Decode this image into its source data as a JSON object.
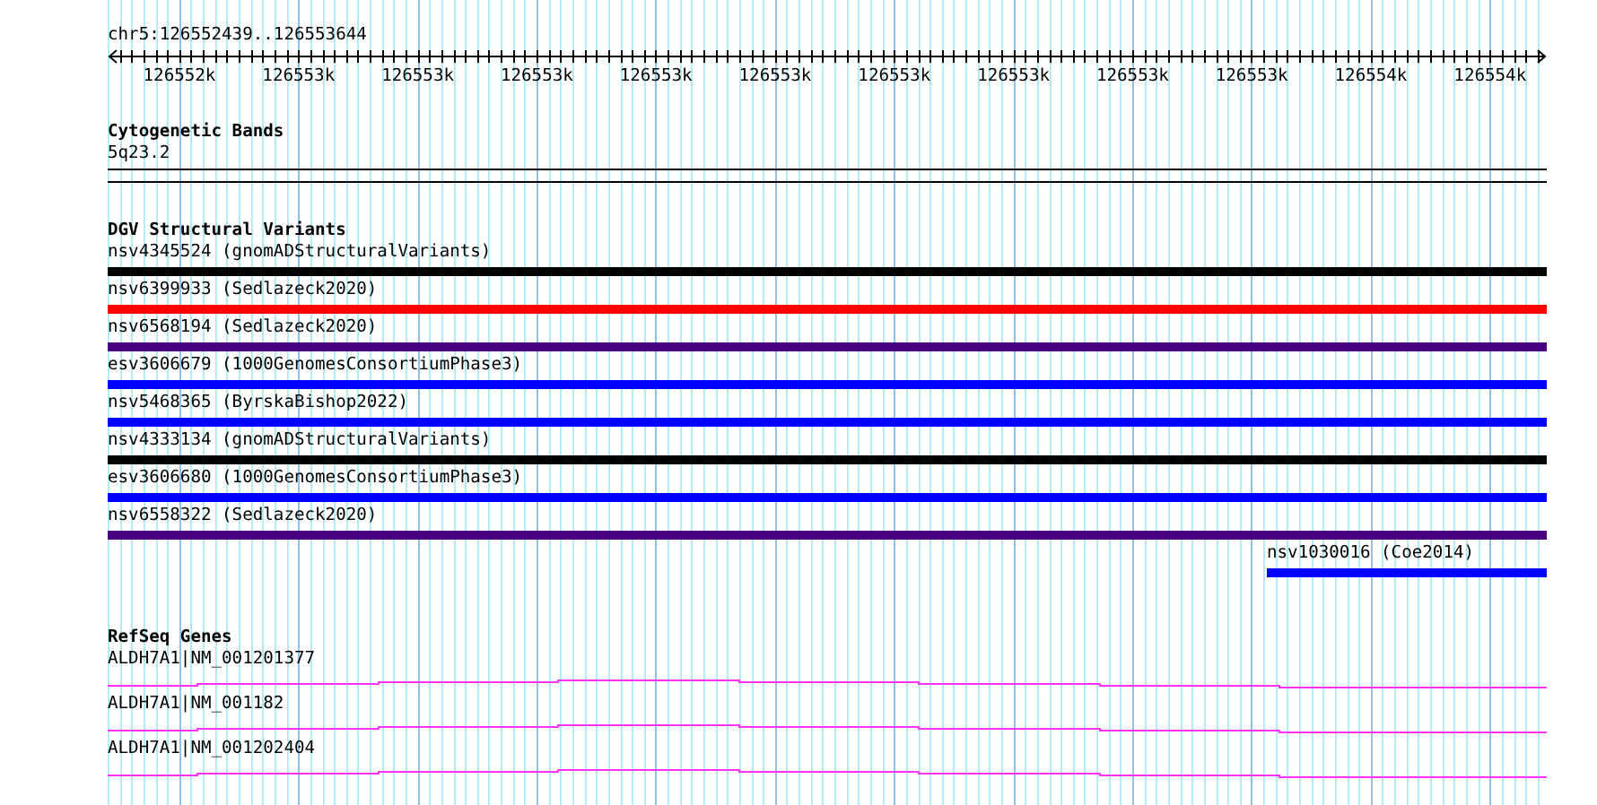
{
  "ruler": {
    "location": "chr5:126552439..126553644",
    "tick_labels": [
      "126552k",
      "126553k",
      "126553k",
      "126553k",
      "126553k",
      "126553k",
      "126553k",
      "126553k",
      "126553k",
      "126553k",
      "126554k",
      "126554k"
    ]
  },
  "cytogenetic_bands": {
    "title": "Cytogenetic Bands",
    "band": "5q23.2"
  },
  "dgv_structural_variants": {
    "title": "DGV Structural Variants",
    "variants": [
      {
        "label": "nsv4345524 (gnomADStructuralVariants)",
        "color": "#000000",
        "kind": "spanning"
      },
      {
        "label": "nsv6399933 (Sedlazeck2020)",
        "color": "#ff0000",
        "kind": "spanning"
      },
      {
        "label": "nsv6568194 (Sedlazeck2020)",
        "color": "#4b0082",
        "kind": "spanning"
      },
      {
        "label": "esv3606679 (1000GenomesConsortiumPhase3)",
        "color": "#0000ff",
        "kind": "spanning"
      },
      {
        "label": "nsv5468365 (ByrskaBishop2022)",
        "color": "#0000ff",
        "kind": "spanning"
      },
      {
        "label": "nsv4333134 (gnomADStructuralVariants)",
        "color": "#000000",
        "kind": "spanning"
      },
      {
        "label": "esv3606680 (1000GenomesConsortiumPhase3)",
        "color": "#0000ff",
        "kind": "spanning"
      },
      {
        "label": "nsv6558322 (Sedlazeck2020)",
        "color": "#4b0082",
        "kind": "spanning"
      },
      {
        "label": "nsv1030016 (Coe2014)",
        "color": "#0000ff",
        "kind": "partial",
        "level": 0.195
      }
    ]
  },
  "refseq_genes": {
    "title": "RefSeq Genes",
    "transcripts": [
      {
        "label": "ALDH7A1|NM_001201377"
      },
      {
        "label": "ALDH7A1|NM_001182"
      },
      {
        "label": "ALDH7A1|NM_001202404"
      }
    ]
  }
}
